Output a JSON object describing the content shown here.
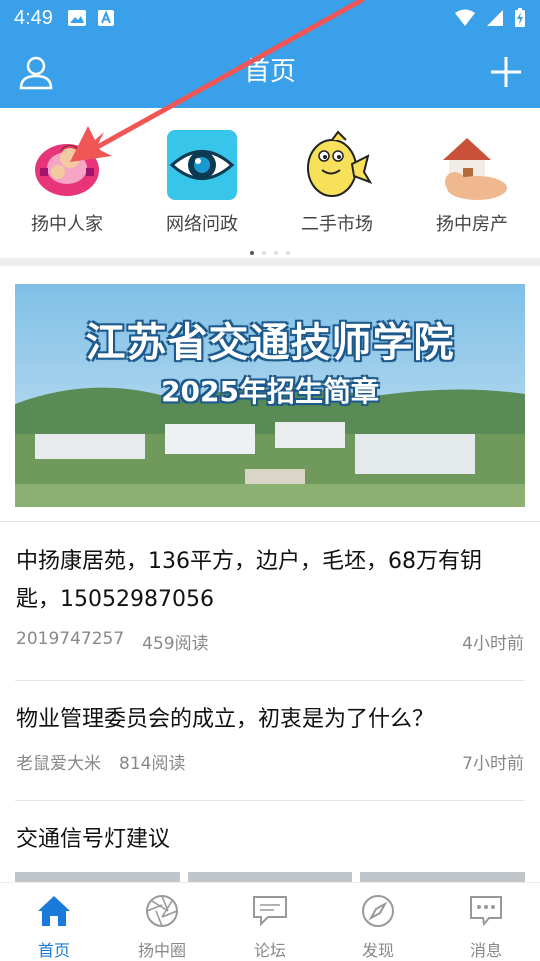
{
  "status_bar": {
    "time": "4:49"
  },
  "header": {
    "title": "首页"
  },
  "quick_links": [
    {
      "label": "扬中人家",
      "icon": "family-avatar-icon"
    },
    {
      "label": "网络问政",
      "icon": "eye-icon"
    },
    {
      "label": "二手市场",
      "icon": "fish-icon"
    },
    {
      "label": "扬中房产",
      "icon": "house-icon"
    }
  ],
  "banner": {
    "line1": "江苏省交通技师学院",
    "line2": "2025年招生简章"
  },
  "articles": [
    {
      "title": "中扬康居苑，136平方，边户，毛坯，68万有钥匙，15052987056",
      "author": "2019747257",
      "reads": "459阅读",
      "time": "4小时前"
    },
    {
      "title": "物业管理委员会的成立，初衷是为了什么？",
      "author": "老鼠爱大米",
      "reads": "814阅读",
      "time": "7小时前"
    },
    {
      "title": "交通信号灯建议"
    }
  ],
  "tabs": [
    {
      "label": "首页",
      "icon": "home-icon",
      "active": true
    },
    {
      "label": "扬中圈",
      "icon": "aperture-icon"
    },
    {
      "label": "论坛",
      "icon": "chat-bubbles-icon"
    },
    {
      "label": "发现",
      "icon": "compass-icon"
    },
    {
      "label": "消息",
      "icon": "message-icon"
    }
  ],
  "colors": {
    "primary": "#3aa0ea",
    "active_tab": "#1a7ad9",
    "annotation_arrow": "#f05656"
  }
}
